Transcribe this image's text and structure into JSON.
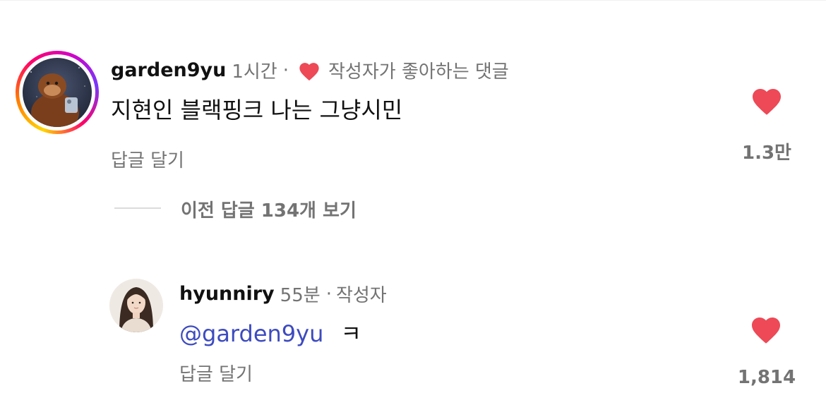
{
  "comment": {
    "username": "garden9yu",
    "time": "1시간",
    "separator": "·",
    "liked_by_author": "작성자가 좋아하는 댓글",
    "text": "지현인 블랙핑크 나는 그냥시민",
    "reply_label": "답글 달기",
    "like_count": "1.3만",
    "avatar_icon": "orangutan-photo",
    "heart_color": "#ed4956"
  },
  "view_replies": {
    "label": "이전 답글 134개 보기"
  },
  "reply": {
    "username": "hyunniry",
    "time": "55분",
    "separator": "·",
    "author_badge": "작성자",
    "mention": "@garden9yu",
    "text": "ㅋ",
    "reply_label": "답글 달기",
    "like_count": "1,814",
    "avatar_icon": "woman-portrait-photo",
    "mention_color": "#3d4bbf"
  }
}
